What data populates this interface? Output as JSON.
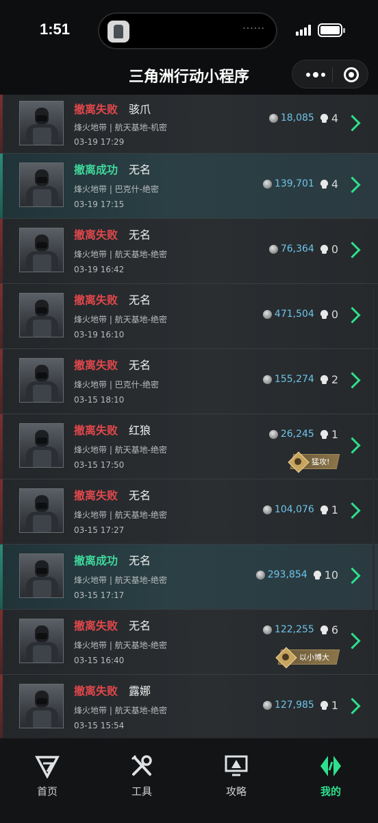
{
  "status_bar": {
    "time": "1:51",
    "island_indicator": "······"
  },
  "header": {
    "title": "三角洲行动小程序",
    "menu_icon": "more-dots-icon",
    "close_icon": "target-circle-icon"
  },
  "records": [
    {
      "result": "撤离失败",
      "result_type": "fail",
      "operator": "骇爪",
      "mode": "烽火地带 | 航天基地-机密",
      "datetime": "03-19 17:29",
      "value": "18,085",
      "kills": "4",
      "badge": ""
    },
    {
      "result": "撤离成功",
      "result_type": "success",
      "operator": "无名",
      "mode": "烽火地带 | 巴克什-绝密",
      "datetime": "03-19 17:15",
      "value": "139,701",
      "kills": "4",
      "badge": ""
    },
    {
      "result": "撤离失败",
      "result_type": "fail",
      "operator": "无名",
      "mode": "烽火地带 | 航天基地-绝密",
      "datetime": "03-19 16:42",
      "value": "76,364",
      "kills": "0",
      "badge": ""
    },
    {
      "result": "撤离失败",
      "result_type": "fail",
      "operator": "无名",
      "mode": "烽火地带 | 航天基地-绝密",
      "datetime": "03-19 16:10",
      "value": "471,504",
      "kills": "0",
      "badge": ""
    },
    {
      "result": "撤离失败",
      "result_type": "fail",
      "operator": "无名",
      "mode": "烽火地带 | 巴克什-绝密",
      "datetime": "03-15 18:10",
      "value": "155,274",
      "kills": "2",
      "badge": ""
    },
    {
      "result": "撤离失败",
      "result_type": "fail",
      "operator": "红狼",
      "mode": "烽火地带 | 航天基地-绝密",
      "datetime": "03-15 17:50",
      "value": "26,245",
      "kills": "1",
      "badge": "猛攻!"
    },
    {
      "result": "撤离失败",
      "result_type": "fail",
      "operator": "无名",
      "mode": "烽火地带 | 航天基地-绝密",
      "datetime": "03-15 17:27",
      "value": "104,076",
      "kills": "1",
      "badge": ""
    },
    {
      "result": "撤离成功",
      "result_type": "success",
      "operator": "无名",
      "mode": "烽火地带 | 航天基地-绝密",
      "datetime": "03-15 17:17",
      "value": "293,854",
      "kills": "10",
      "badge": ""
    },
    {
      "result": "撤离失败",
      "result_type": "fail",
      "operator": "无名",
      "mode": "烽火地带 | 航天基地-绝密",
      "datetime": "03-15 16:40",
      "value": "122,255",
      "kills": "6",
      "badge": "以小博大"
    },
    {
      "result": "撤离失败",
      "result_type": "fail",
      "operator": "露娜",
      "mode": "烽火地带 | 航天基地-绝密",
      "datetime": "03-15 15:54",
      "value": "127,985",
      "kills": "1",
      "badge": ""
    }
  ],
  "bottom_nav": [
    {
      "label": "首页",
      "icon": "home-logo-icon",
      "active": false
    },
    {
      "label": "工具",
      "icon": "tools-icon",
      "active": false
    },
    {
      "label": "攻略",
      "icon": "guide-monitor-icon",
      "active": false
    },
    {
      "label": "我的",
      "icon": "profile-logo-icon",
      "active": true
    }
  ],
  "colors": {
    "fail": "#e2474b",
    "success": "#3fd79a",
    "value": "#6fc4ea",
    "accent": "#2ee08d",
    "background": "#0c0e0f"
  }
}
